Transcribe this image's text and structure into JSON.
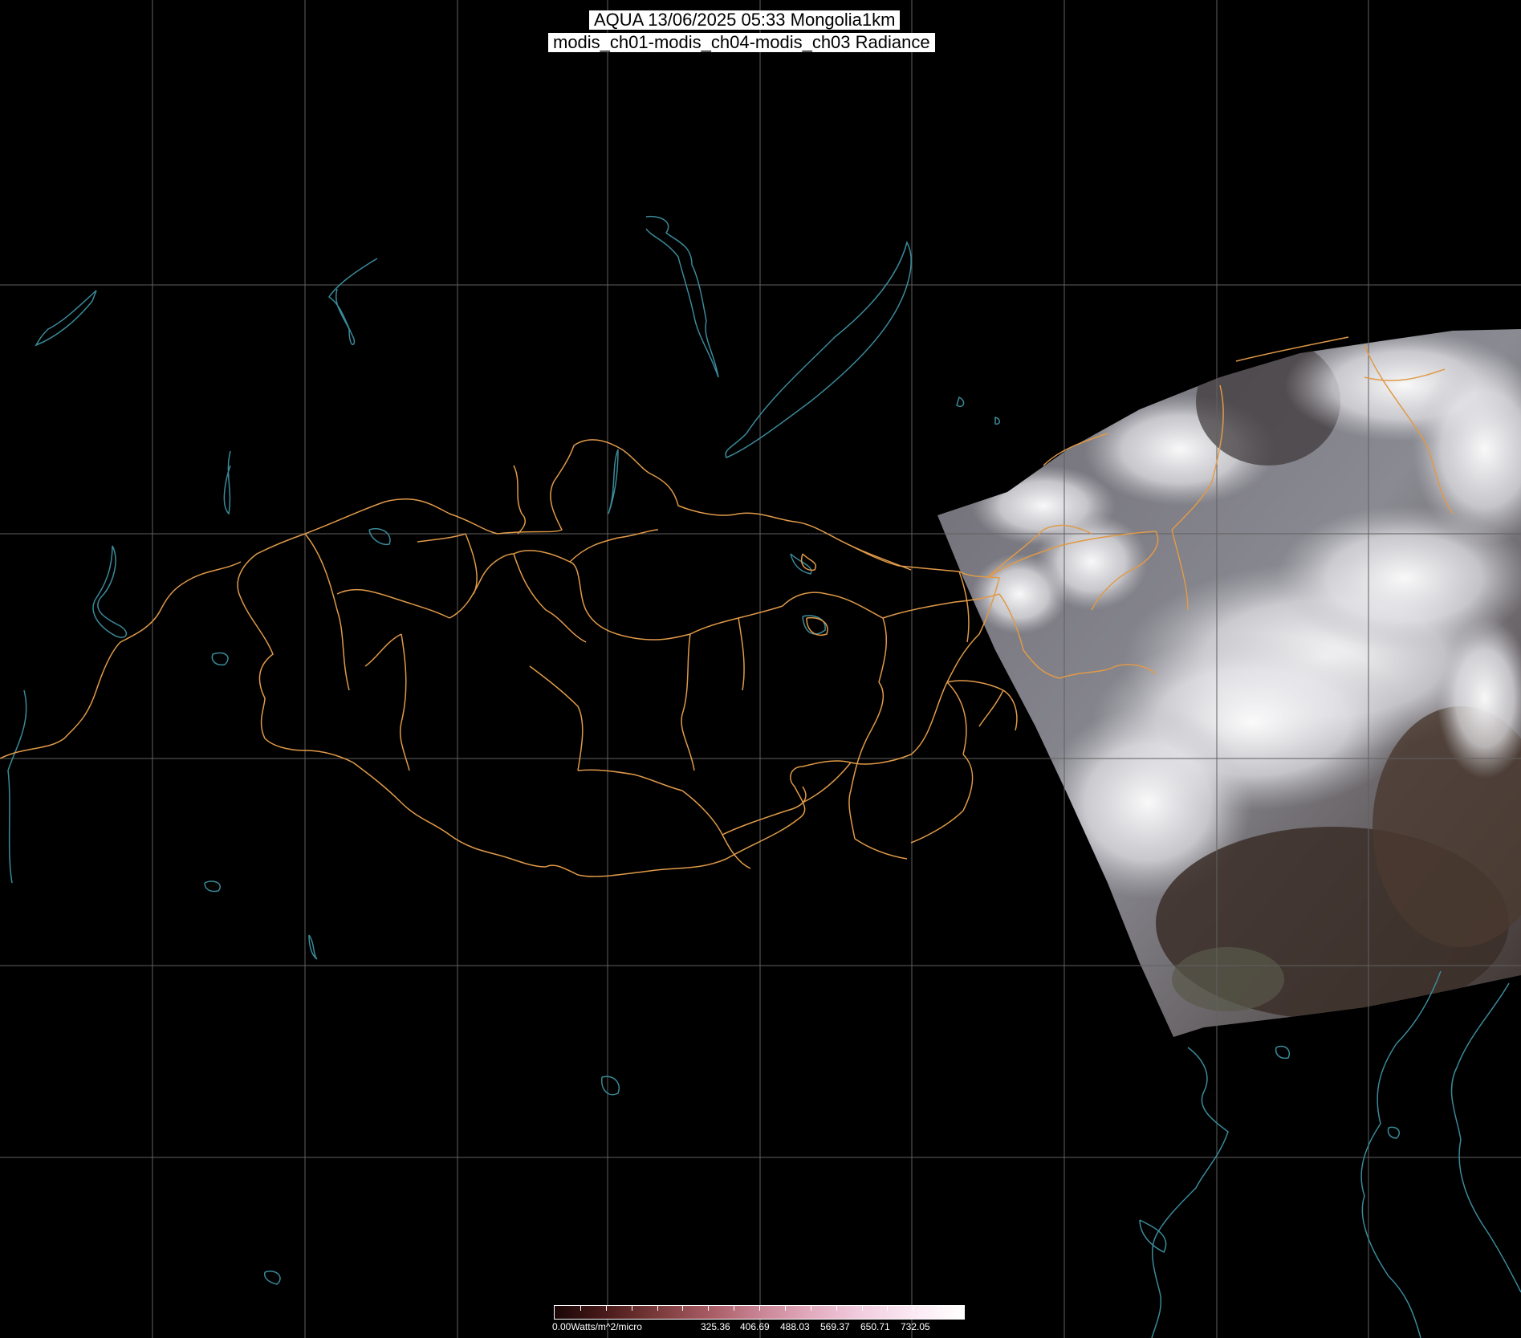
{
  "header": {
    "title_line1": "AQUA 13/06/2025 05:33 Mongolia1km",
    "title_line2": "modis_ch01-modis_ch04-modis_ch03 Radiance"
  },
  "colorbar": {
    "labels": [
      "0.00Watts/m^2/micro",
      "325.36",
      "406.69",
      "488.03",
      "569.37",
      "650.71",
      "732.05"
    ],
    "colors": [
      "#1a0606",
      "#4a1a1a",
      "#7a3a3a",
      "#a65a62",
      "#c98494",
      "#e2aabd",
      "#f2cde0",
      "#fbe9f3",
      "#ffffff"
    ]
  },
  "map": {
    "background": "#000000",
    "grid_color": "#606060",
    "border_color": "#e09a48",
    "coast_color": "#3a8a9a",
    "features": [
      "graticule",
      "mongolia-aimag-borders",
      "lake-baikal",
      "coastlines",
      "modis-swath"
    ]
  }
}
